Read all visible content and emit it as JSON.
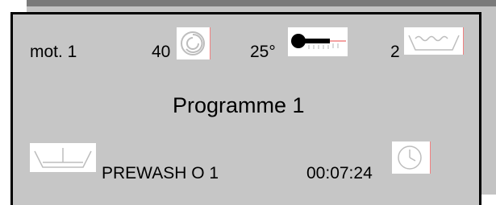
{
  "status_row": {
    "motor_label": "mot. 1",
    "speed_value": "40",
    "speed_icon": "spin-icon",
    "temperature_value": "25°",
    "temperature_icon": "thermometer-icon",
    "water_level_value": "2",
    "water_level_icon": "water-level-icon"
  },
  "program": {
    "title": "Programme 1"
  },
  "phase_row": {
    "phase_icon": "drum-tub-icon",
    "phase_label": "PREWASH O 1",
    "time_remaining": "00:07:24",
    "time_icon": "clock-icon"
  },
  "colors": {
    "panel_background": "#c6c6c6",
    "border": "#000000",
    "icon_line": "#c0c0c0",
    "icon_accent": "#ff9999"
  }
}
